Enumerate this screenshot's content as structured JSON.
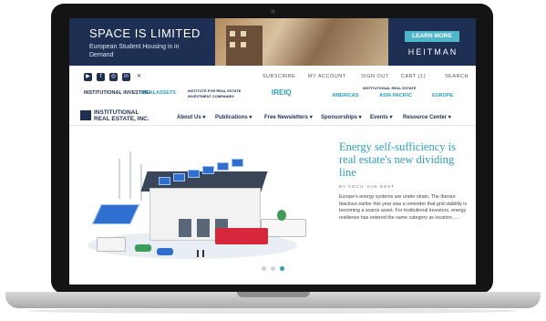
{
  "ad": {
    "headline": "SPACE IS LIMITED",
    "subtext": "European Student Housing is in Demand",
    "cta": "LEARN MORE",
    "brand": "HEITMAN"
  },
  "social_icons": [
    "youtube-icon",
    "facebook-icon",
    "instagram-icon",
    "linkedin-icon",
    "x-icon"
  ],
  "utility_links": {
    "subscribe": "SUBSCRIBE",
    "account": "MY ACCOUNT",
    "signout": "SIGN OUT",
    "cart": "CART (1)",
    "search": "SEARCH"
  },
  "partners": {
    "iii": "INSTITUTIONAL INVESTING",
    "realassets": "REALASSETS",
    "irei_inst": "INSTITUTE FOR REAL ESTATE INVESTMENT COMPANIES",
    "ireiq": "IREIQ",
    "americas": "AMERICAS",
    "ire_header": "INSTITUTIONAL REAL ESTATE",
    "asia": "ASIA PACIFIC",
    "europe": "EUROPE"
  },
  "logo": {
    "line1": "INSTITUTIONAL",
    "line2": "REAL ESTATE, INC."
  },
  "nav": [
    "About Us",
    "Publications",
    "Free Newsletters",
    "Sponsorships",
    "Events",
    "Resource Center"
  ],
  "article": {
    "title": "Energy self-sufficiency is real estate's new dividing line",
    "author": "BY CECIL VAN DOST",
    "body": "Europe's energy systems are under strain. The Iberian blackout earlier this year was a reminder that grid stability is becoming a scarce asset. For institutional investors, energy resilience has entered the same category as location, ..."
  },
  "carousel": {
    "count": 3,
    "active_index": 2
  },
  "colors": {
    "navy": "#1d2f52",
    "accent": "#2a9fc0"
  }
}
